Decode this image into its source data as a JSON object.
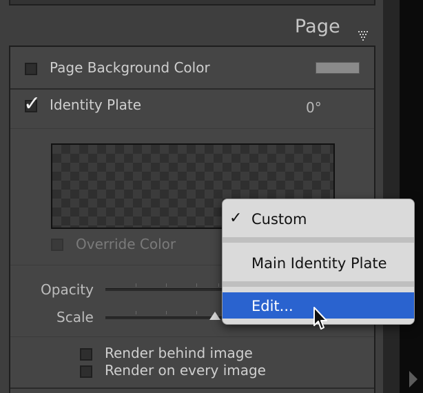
{
  "panel": {
    "title": "Page",
    "page_background_color": {
      "label": "Page Background Color",
      "checked": false,
      "swatch_color": "#8a8a8a"
    },
    "identity_plate": {
      "label": "Identity Plate",
      "checked": true,
      "angle": "0°"
    },
    "override_color": {
      "label": "Override Color",
      "checked": false
    },
    "opacity": {
      "label": "Opacity"
    },
    "scale": {
      "label": "Scale"
    },
    "render_behind_image": {
      "label": "Render behind image",
      "checked": false
    },
    "render_on_every_image": {
      "label": "Render on every image",
      "checked": false
    }
  },
  "dropdown": {
    "items": [
      {
        "label": "Custom",
        "checked": true,
        "checkmark": "✓"
      },
      {
        "label": "Main Identity Plate",
        "checked": false
      },
      {
        "label": "Edit...",
        "highlighted": true
      }
    ],
    "highlight_color": "#2a63cf"
  },
  "colors": {
    "panel_bg": "#454545",
    "frame_bg": "#3e3e3e"
  }
}
